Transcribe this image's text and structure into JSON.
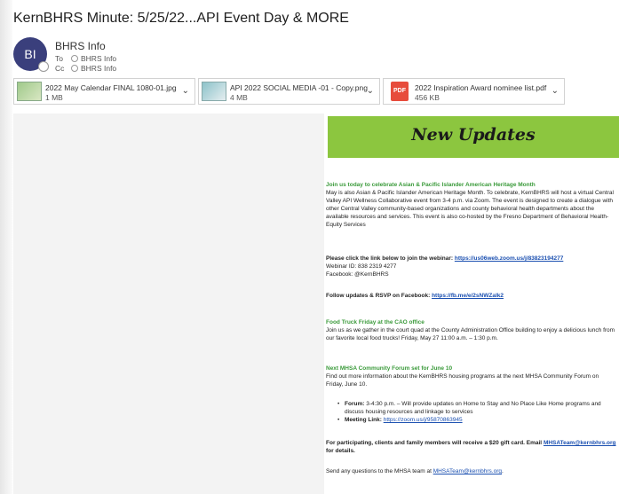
{
  "email": {
    "subject": "KernBHRS Minute: 5/25/22...API Event Day & MORE",
    "sender": {
      "initials": "BI",
      "name": "BHRS Info",
      "to_label": "To",
      "to_value": "BHRS Info",
      "cc_label": "Cc",
      "cc_value": "BHRS Info"
    },
    "attachments": [
      {
        "name": "2022 May Calendar FINAL 1080-01.jpg",
        "size": "1 MB",
        "icon": "image-thumbnail-icon"
      },
      {
        "name": "API 2022 SOCIAL MEDIA -01 - Copy.png",
        "size": "4 MB",
        "icon": "image-thumbnail-icon"
      },
      {
        "name": "2022 Inspiration Award nominee list.pdf",
        "size": "456 KB",
        "icon": "pdf-icon",
        "icon_label": "PDF"
      }
    ]
  },
  "newsletter": {
    "banner_title": "New Updates",
    "api": {
      "heading": "Join us today to celebrate Asian & Pacific Islander American Heritage Month",
      "body": "May is also Asian & Pacific Islander American Heritage Month. To celebrate, KernBHRS will host a virtual Central Valley API Wellness Collaborative event from 3-4 p.m. via Zoom. The event is designed to create a dialogue with other Central Valley community-based organizations and county behavioral health departments about the available resources and services. This event is also co-hosted by the Fresno Department of Behavioral Health- Equity Services",
      "join_label": "Please click the link below to join the webinar:",
      "join_link": "https://us06web.zoom.us/j/83823194277",
      "webinar_id": "Webinar ID: 838 2319 4277",
      "facebook": "Facebook: @KernBHRS",
      "follow_label": "Follow updates & RSVP on Facebook:",
      "follow_link": "https://fb.me/e/2sNWZalk2"
    },
    "food_truck": {
      "heading": "Food Truck Friday at the CAO office",
      "body": "Join us as we gather in the court quad at the County Administration Office building to enjoy a delicious lunch from our favorite local food trucks! Friday, May 27 11:00 a.m. – 1:30 p.m."
    },
    "mhsa": {
      "heading": "Next MHSA Community Forum set for June 10",
      "body": "Find out more information about the KernBHRS housing programs at the next MHSA Community Forum on Friday, June 10.",
      "forum_label": "Forum:",
      "forum_text": "3-4:30 p.m. – Will provide updates on Home to Stay and No Place Like Home programs and discuss housing resources and linkage to services",
      "meeting_label": "Meeting Link:",
      "meeting_link": "https://zoom.us/j/95870863945",
      "gift_text": "For participating, clients and family members will receive a $20 gift card. Email",
      "gift_email": "MHSATeam@kernbhrs.org",
      "gift_suffix": "for details.",
      "questions_text": "Send any questions to the MHSA team at",
      "questions_email": "MHSATeam@kernbhrs.org",
      "questions_suffix": "."
    }
  },
  "colors": {
    "banner": "#8cc63f",
    "heading_green": "#3a9a3a",
    "link": "#1a4fb0",
    "avatar": "#3a3f7c"
  }
}
